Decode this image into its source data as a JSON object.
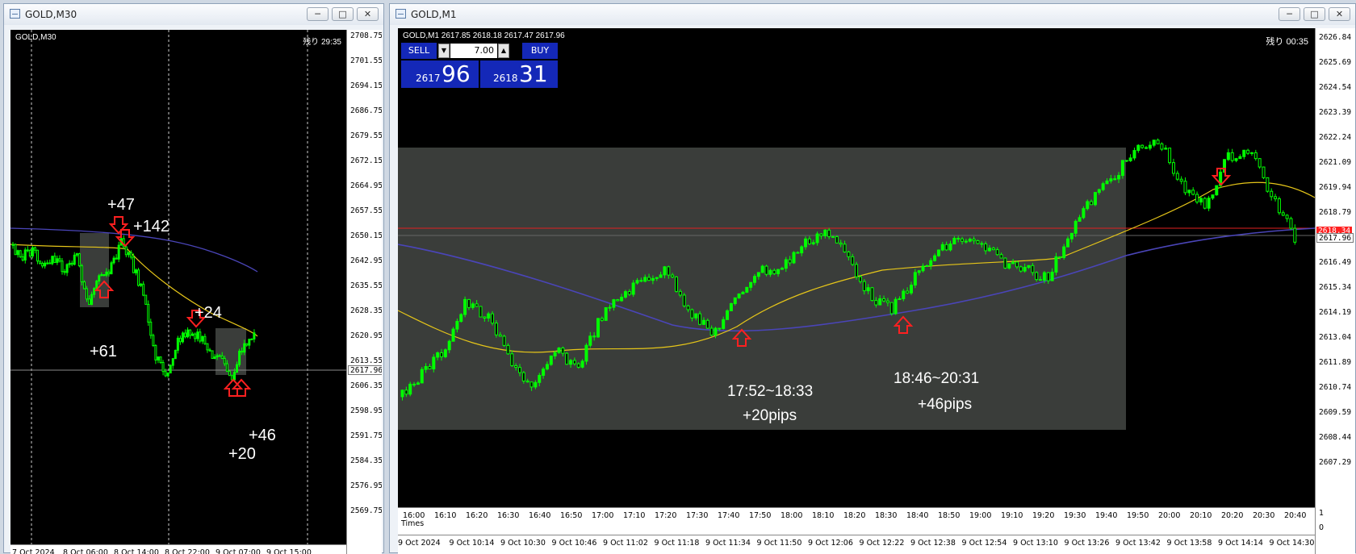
{
  "left": {
    "window_title": "GOLD,M30",
    "symbol_label": "GOLD,M30",
    "countdown": "残り 29:35",
    "price_ticks": [
      "2708.75",
      "2701.55",
      "2694.15",
      "2686.75",
      "2679.55",
      "2672.15",
      "2664.95",
      "2657.55",
      "2650.15",
      "2642.95",
      "2635.55",
      "2628.35",
      "2620.95",
      "2613.55",
      "2606.35",
      "2598.95",
      "2591.75",
      "2584.35",
      "2576.95",
      "2569.75"
    ],
    "current_price": "2617.96",
    "time_ticks": [
      "7 Oct 2024",
      "8 Oct 06:00",
      "8 Oct 14:00",
      "8 Oct 22:00",
      "9 Oct 07:00",
      "9 Oct 15:00"
    ],
    "annotations": [
      "+47",
      "+142",
      "+61",
      "+24",
      "+46",
      "+20"
    ]
  },
  "right": {
    "window_title": "GOLD,M1",
    "symbol_label": "GOLD,M1  2617.85 2618.18 2617.47 2617.96",
    "countdown": "残り 00:35",
    "one_click": {
      "sell_label": "SELL",
      "buy_label": "BUY",
      "lot": "7.00",
      "sell_small": "2617",
      "sell_big": "96",
      "buy_small": "2618",
      "buy_big": "31"
    },
    "price_ticks": [
      "2626.84",
      "2625.69",
      "2624.54",
      "2623.39",
      "2622.24",
      "2621.09",
      "2619.94",
      "2618.79",
      "2617.64",
      "2616.49",
      "2615.34",
      "2614.19",
      "2613.04",
      "2611.89",
      "2610.74",
      "2609.59",
      "2608.44",
      "2607.29"
    ],
    "red_line_price": "2618.34",
    "current_price": "2617.96",
    "sub_axis_ticks": [
      "1",
      "0"
    ],
    "sub_label": "Times",
    "sub_time_ticks": [
      "16:00",
      "16:10",
      "16:20",
      "16:30",
      "16:40",
      "16:50",
      "17:00",
      "17:10",
      "17:20",
      "17:30",
      "17:40",
      "17:50",
      "18:00",
      "18:10",
      "18:20",
      "18:30",
      "18:40",
      "18:50",
      "19:00",
      "19:10",
      "19:20",
      "19:30",
      "19:40",
      "19:50",
      "20:00",
      "20:10",
      "20:20",
      "20:30",
      "20:40"
    ],
    "time_ticks": [
      "9 Oct 2024",
      "9 Oct 10:14",
      "9 Oct 10:30",
      "9 Oct 10:46",
      "9 Oct 11:02",
      "9 Oct 11:18",
      "9 Oct 11:34",
      "9 Oct 11:50",
      "9 Oct 12:06",
      "9 Oct 12:22",
      "9 Oct 12:38",
      "9 Oct 12:54",
      "9 Oct 13:10",
      "9 Oct 13:26",
      "9 Oct 13:42",
      "9 Oct 13:58",
      "9 Oct 14:14",
      "9 Oct 14:30"
    ],
    "annotation1": {
      "range": "17:52~18:33",
      "pips": "+20pips"
    },
    "annotation2": {
      "range": "18:46~20:31",
      "pips": "+46pips"
    }
  },
  "colors": {
    "candle": "#00ff00",
    "ma_fast": "#e6c619",
    "ma_slow": "#4a45b8",
    "arrow": "#ff2020",
    "highlight": "#3a3d3a"
  }
}
